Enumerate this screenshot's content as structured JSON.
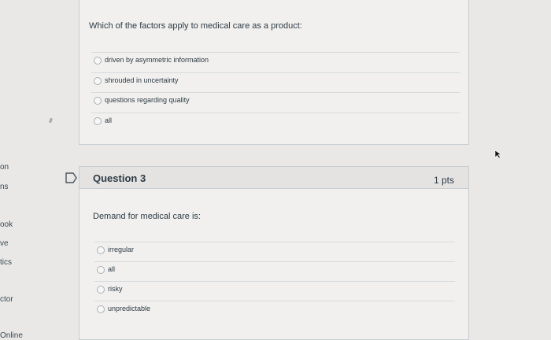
{
  "left_nav": {
    "items": [
      "on",
      "ns",
      "ook",
      "ve",
      "tics",
      "ctor",
      "Online"
    ]
  },
  "question2": {
    "text": "Which of the factors apply to medical care as a product:",
    "answers": [
      "driven by asymmetric information",
      "shrouded in uncertainty",
      "questions regarding quality",
      "all"
    ]
  },
  "question3": {
    "title": "Question 3",
    "points": "1 pts",
    "text": "Demand for medical care is:",
    "answers": [
      "irregular",
      "all",
      "risky",
      "unpredictable"
    ]
  },
  "icons": {
    "flag": "flag-icon",
    "cursor": "cursor-icon"
  },
  "colors": {
    "background": "#e9e8e6",
    "box": "#f1f0ee",
    "header": "#e4e3e1",
    "border": "#c7cdd1"
  }
}
